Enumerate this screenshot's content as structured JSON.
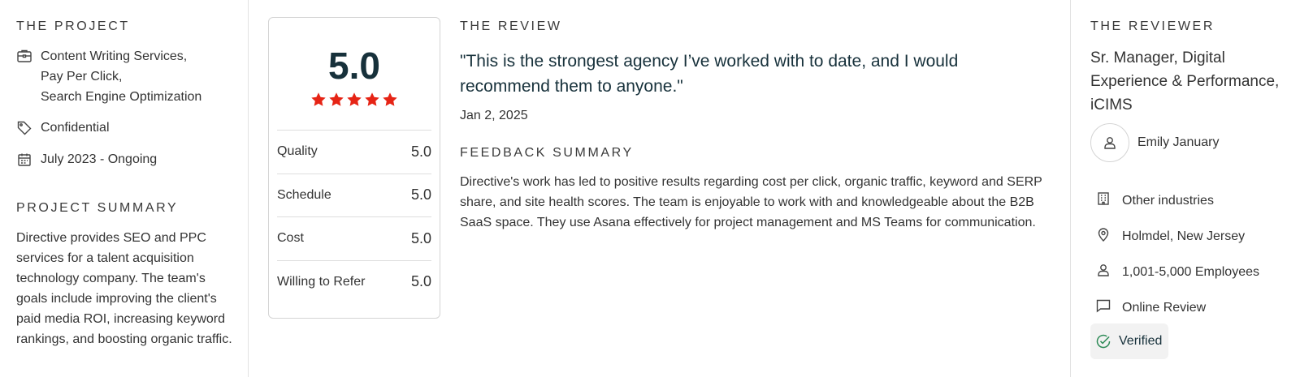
{
  "project": {
    "heading": "THE PROJECT",
    "services": [
      "Content Writing Services,",
      "Pay Per Click,",
      "Search Engine Optimization"
    ],
    "budget": "Confidential",
    "dates": "July 2023 - Ongoing",
    "summary_heading": "PROJECT SUMMARY",
    "summary": "Directive provides SEO and PPC services for a talent acquisition technology company. The team's goals include improving the client's paid media ROI, increasing keyword rankings, and boosting organic traffic."
  },
  "rating": {
    "overall": "5.0",
    "stars": 5,
    "star_color": "#e62415",
    "rows": [
      {
        "label": "Quality",
        "value": "5.0"
      },
      {
        "label": "Schedule",
        "value": "5.0"
      },
      {
        "label": "Cost",
        "value": "5.0"
      },
      {
        "label": "Willing to Refer",
        "value": "5.0"
      }
    ]
  },
  "review": {
    "heading": "THE REVIEW",
    "quote": "\"This is the strongest agency I’ve worked with to date, and I would recommend them to anyone.\"",
    "date": "Jan 2, 2025",
    "feedback_heading": "FEEDBACK SUMMARY",
    "feedback": "Directive's work has led to positive results regarding cost per click, organic traffic, keyword and SERP share, and site health scores. The team is enjoyable to work with and knowledgeable about the B2B SaaS space. They use Asana effectively for project management and MS Teams for communication."
  },
  "reviewer": {
    "heading": "THE REVIEWER",
    "title": "Sr. Manager, Digital Experience & Performance, iCIMS",
    "name": "Emily January",
    "industry": "Other industries",
    "location": "Holmdel, New Jersey",
    "company_size": "1,001-5,000 Employees",
    "review_method": "Online Review",
    "verified": "Verified",
    "verified_color": "#2e8b57"
  },
  "icons": {
    "services": "briefcase-icon",
    "budget": "tag-icon",
    "dates": "calendar-icon",
    "avatar": "user-icon",
    "industry": "building-icon",
    "location": "map-pin-icon",
    "size": "user-icon",
    "method": "chat-bubble-icon",
    "verified": "check-circle-icon"
  }
}
